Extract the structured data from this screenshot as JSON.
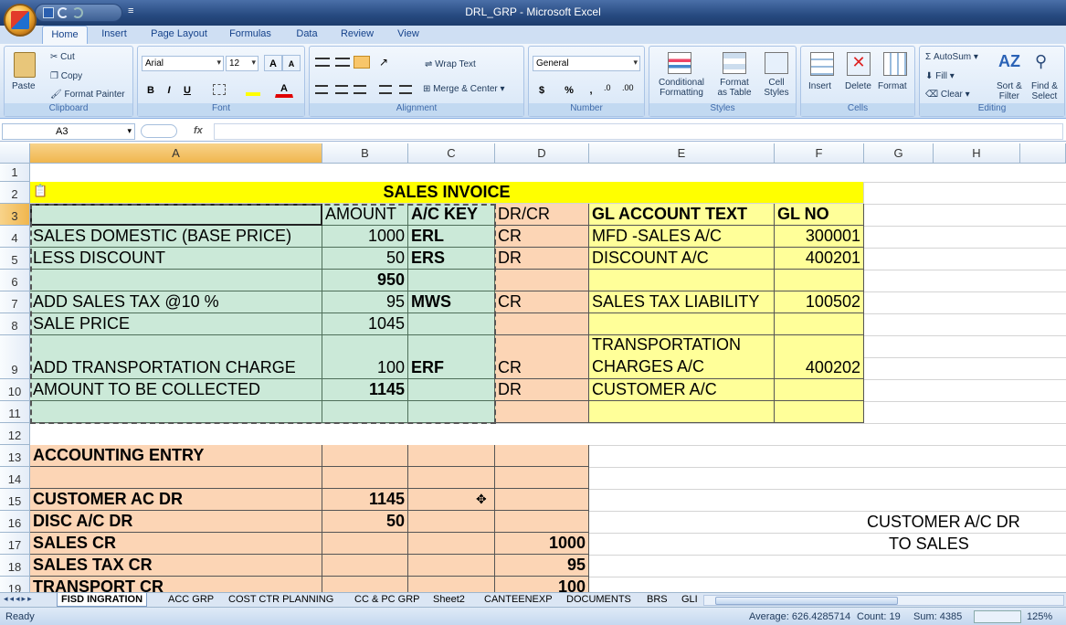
{
  "window": {
    "title": "DRL_GRP - Microsoft Excel"
  },
  "ribbon": {
    "tabs": [
      "Home",
      "Insert",
      "Page Layout",
      "Formulas",
      "Data",
      "Review",
      "View"
    ],
    "clipboard": {
      "paste": "Paste",
      "cut": "Cut",
      "copy": "Copy",
      "format_painter": "Format Painter",
      "label": "Clipboard"
    },
    "font": {
      "name": "Arial",
      "size": "12",
      "label": "Font",
      "bold": "B",
      "italic": "I",
      "underline": "U"
    },
    "alignment": {
      "wrap_text": "Wrap Text",
      "merge_center": "Merge & Center",
      "label": "Alignment"
    },
    "number": {
      "format": "General",
      "currency": "$",
      "percent": "%",
      "comma": ",",
      "label": "Number"
    },
    "styles": {
      "conditional": "Conditional",
      "conditional2": "Formatting",
      "format_table": "Format",
      "format_table2": "as Table",
      "cell_styles": "Cell",
      "cell_styles2": "Styles",
      "label": "Styles"
    },
    "cells": {
      "insert": "Insert",
      "delete": "Delete",
      "format": "Format",
      "label": "Cells"
    },
    "editing": {
      "autosum": "AutoSum",
      "fill": "Fill",
      "clear": "Clear",
      "sort": "Sort &",
      "sort2": "Filter",
      "find": "Find &",
      "find2": "Select",
      "label": "Editing"
    }
  },
  "formula_bar": {
    "name_box": "A3",
    "fx": "fx",
    "formula": ""
  },
  "columns": [
    "A",
    "B",
    "C",
    "D",
    "E",
    "F",
    "G",
    "H"
  ],
  "rows": [
    "1",
    "2",
    "3",
    "4",
    "5",
    "6",
    "7",
    "8",
    "9",
    "10",
    "11",
    "12",
    "13",
    "14",
    "15",
    "16",
    "17",
    "18",
    "19"
  ],
  "cells": {
    "title": "SALES INVOICE",
    "B3": "AMOUNT",
    "C3": "A/C KEY",
    "D3": "DR/CR",
    "E3": "GL ACCOUNT  TEXT",
    "F3": "GL NO",
    "A4": "SALES  DOMESTIC (BASE PRICE)",
    "B4": "1000",
    "C4": "ERL",
    "D4": "CR",
    "E4": "MFD -SALES A/C",
    "F4": "300001",
    "A5": "LESS DISCOUNT",
    "B5": "50",
    "C5": "ERS",
    "D5": "DR",
    "E5": "DISCOUNT A/C",
    "F5": "400201",
    "B6": "950",
    "A7": "ADD SALES TAX @10 %",
    "B7": "95",
    "C7": "MWS",
    "D7": "CR",
    "E7": "SALES TAX LIABILITY",
    "F7": "100502",
    "A8": "SALE PRICE",
    "B8": "1045",
    "A9": "ADD TRANSPORTATION CHARGE",
    "B9": "100",
    "C9": "ERF",
    "D9": "CR",
    "E9": "TRANSPORTATION CHARGES A/C",
    "F9": "400202",
    "A10": "AMOUNT TO BE COLLECTED",
    "B10": "1145",
    "D10": "DR",
    "E10": "CUSTOMER A/C",
    "A13": "ACCOUNTING ENTRY",
    "A15": "CUSTOMER AC DR",
    "B15": "1145",
    "A16": "DISC A/C DR",
    "B16": "50",
    "A17": "SALES  CR",
    "D17": "1000",
    "A18": "SALES TAX  CR",
    "D18": "95",
    "A19": "TRANSPORT CR",
    "D19": "100",
    "G16": "CUSTOMER A/C DR",
    "G17": "TO SALES"
  },
  "sheets": [
    "FISD INGRATION",
    "ACC GRP",
    "COST CTR PLANNING",
    "CC & PC GRP",
    "Sheet2",
    "CANTEENEXP",
    "DOCUMENTS",
    "BRS",
    "GLI"
  ],
  "status": {
    "ready": "Ready",
    "average": "Average: 626.4285714",
    "count": "Count: 19",
    "sum": "Sum: 4385",
    "zoom": "125%"
  }
}
